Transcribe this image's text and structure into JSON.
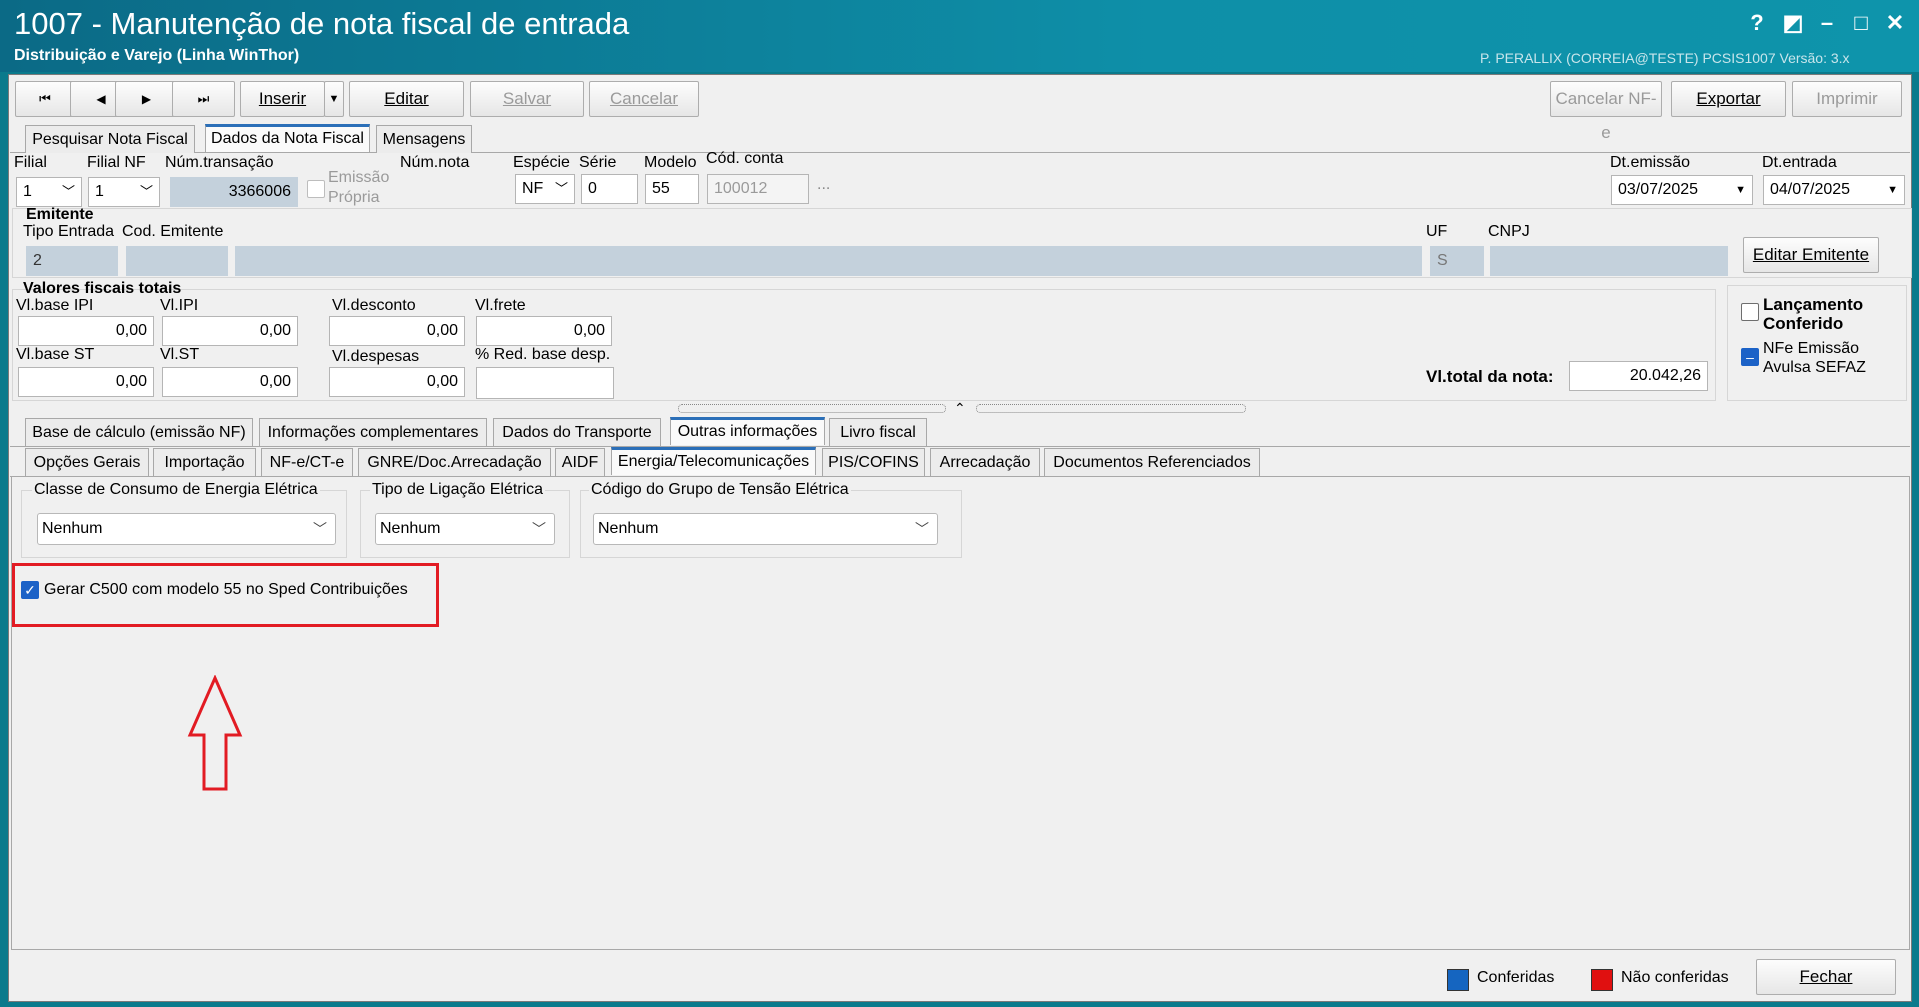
{
  "window": {
    "title": "1007 - Manutenção de nota fiscal de entrada",
    "subtitle": "Distribuição e Varejo (Linha WinThor)",
    "user_info": "P. PERALLIX (CORREIA@TESTE)   PCSIS1007   Versão: 3.x",
    "controls": {
      "help": "?",
      "restore": "◩",
      "minimize": "–",
      "maximize": "□",
      "close": "✕"
    }
  },
  "toolbar": {
    "first": "⏮",
    "prev": "◀",
    "next": "▶",
    "last": "⏭",
    "insert": "Inserir",
    "dropdown": "▼",
    "edit": "Editar",
    "save": "Salvar",
    "cancel": "Cancelar",
    "cancel_nfe": "Cancelar NF-e",
    "export": "Exportar",
    "print": "Imprimir"
  },
  "main_tabs": [
    "Pesquisar Nota Fiscal",
    "Dados da Nota Fiscal",
    "Mensagens"
  ],
  "header_fields": {
    "filial_label": "Filial",
    "filial": "1",
    "filial_nf_label": "Filial NF",
    "filial_nf": "1",
    "num_transacao_label": "Núm.transação",
    "num_transacao": "3366006",
    "emissao_propria": "Emissão Própria",
    "num_nota_label": "Núm.nota",
    "especie_label": "Espécie",
    "especie": "NF",
    "serie_label": "Série",
    "serie": "0",
    "modelo_label": "Modelo",
    "modelo": "55",
    "cod_conta_label": "Cód. conta",
    "cod_conta": "100012",
    "ellipsis": "...",
    "dt_emissao_label": "Dt.emissão",
    "dt_emissao": "03/07/2025",
    "dt_entrada_label": "Dt.entrada",
    "dt_entrada": "04/07/2025"
  },
  "emitente": {
    "title": "Emitente",
    "tipo_entrada_label": "Tipo Entrada",
    "tipo_entrada": "2",
    "cod_emitente_label": "Cod. Emitente",
    "uf_label": "UF",
    "uf": "S",
    "cnpj_label": "CNPJ",
    "edit_button": "Editar Emitente"
  },
  "valores": {
    "title": "Valores fiscais totais",
    "base_ipi_label": "Vl.base IPI",
    "base_ipi": "0,00",
    "ipi_label": "Vl.IPI",
    "ipi": "0,00",
    "desconto_label": "Vl.desconto",
    "desconto": "0,00",
    "frete_label": "Vl.frete",
    "frete": "0,00",
    "base_st_label": "Vl.base ST",
    "base_st": "0,00",
    "st_label": "Vl.ST",
    "st": "0,00",
    "despesas_label": "Vl.despesas",
    "despesas": "0,00",
    "red_base_label": "% Red. base desp.",
    "total_label": "Vl.total da nota:",
    "total": "20.042,26"
  },
  "side_checks": {
    "lancamento_conferido": "Lançamento Conferido",
    "nfe_avulsa": "NFe Emissão Avulsa SEFAZ"
  },
  "sub_tabs_row1": [
    "Base de cálculo (emissão NF)",
    "Informações complementares",
    "Dados do Transporte",
    "Outras informações",
    "Livro fiscal"
  ],
  "sub_tabs_row2": [
    "Opções Gerais",
    "Importação",
    "NF-e/CT-e",
    "GNRE/Doc.Arrecadação",
    "AIDF",
    "Energia/Telecomunicações",
    "PIS/COFINS",
    "Arrecadação",
    "Documentos Referenciados"
  ],
  "energia": {
    "classe_label": "Classe de Consumo de Energia Elétrica",
    "classe_value": "Nenhum",
    "tipo_label": "Tipo de Ligação Elétrica",
    "tipo_value": "Nenhum",
    "grupo_label": "Código do Grupo de Tensão Elétrica",
    "grupo_value": "Nenhum",
    "gerar_c500": "Gerar C500 com modelo 55 no Sped Contribuições"
  },
  "annotation_colors": {
    "highlight_box": "#e21b23",
    "arrow": "#e21b23"
  },
  "footer": {
    "conferidas": "Conferidas",
    "nao_conferidas": "Não conferidas",
    "close": "Fechar",
    "conferidas_color": "#1565c0",
    "nao_conferidas_color": "#e01010"
  }
}
